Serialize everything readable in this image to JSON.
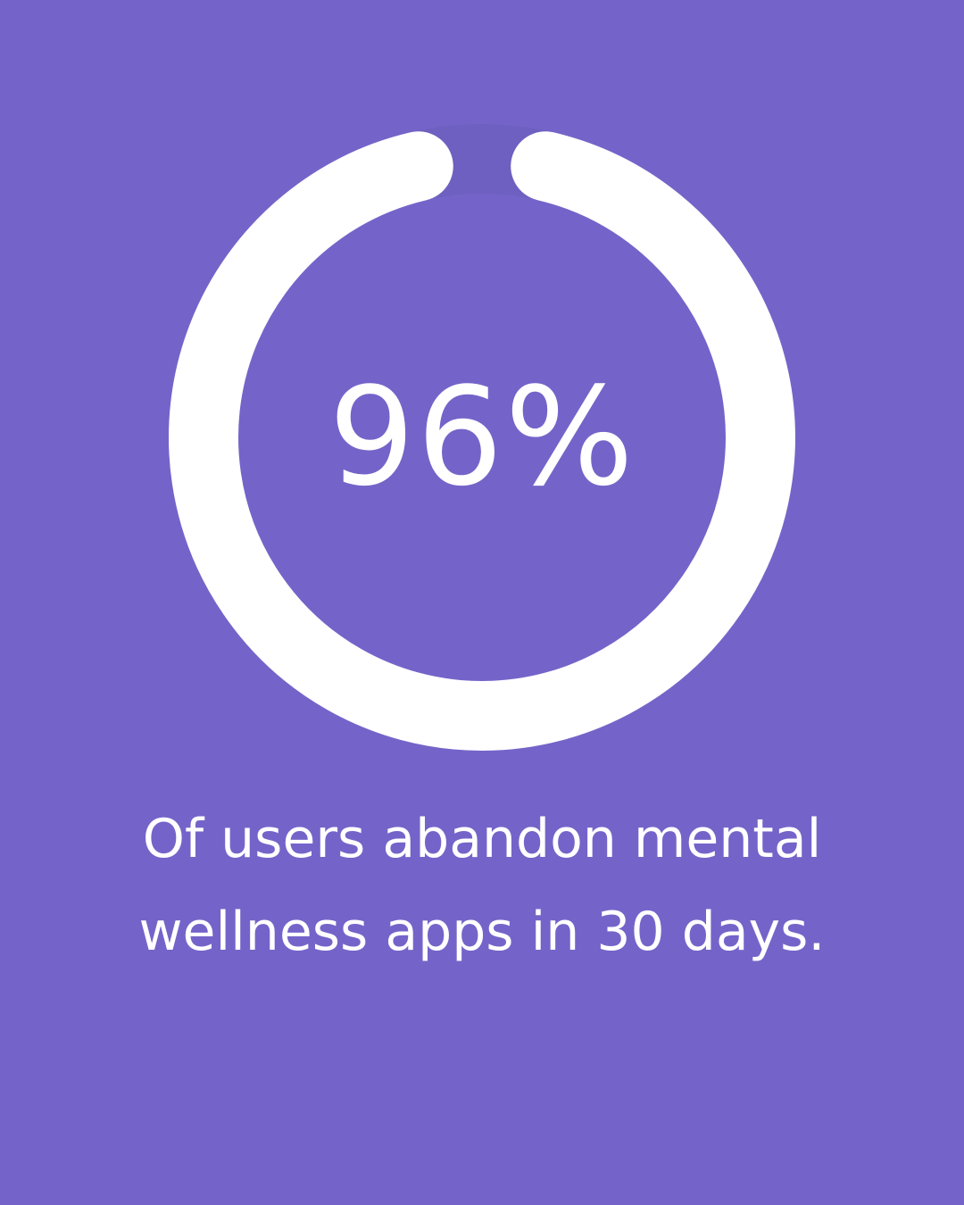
{
  "stat": {
    "value_text": "96%",
    "fraction": 0.96
  },
  "caption": {
    "line1": "Of users abandon mental",
    "line2": "wellness apps in 30 days."
  },
  "colors": {
    "background": "#7464C9",
    "ring_fill": "#FFFFFF",
    "ring_gap": "#6A5DB8",
    "text": "#FFFFFF"
  }
}
